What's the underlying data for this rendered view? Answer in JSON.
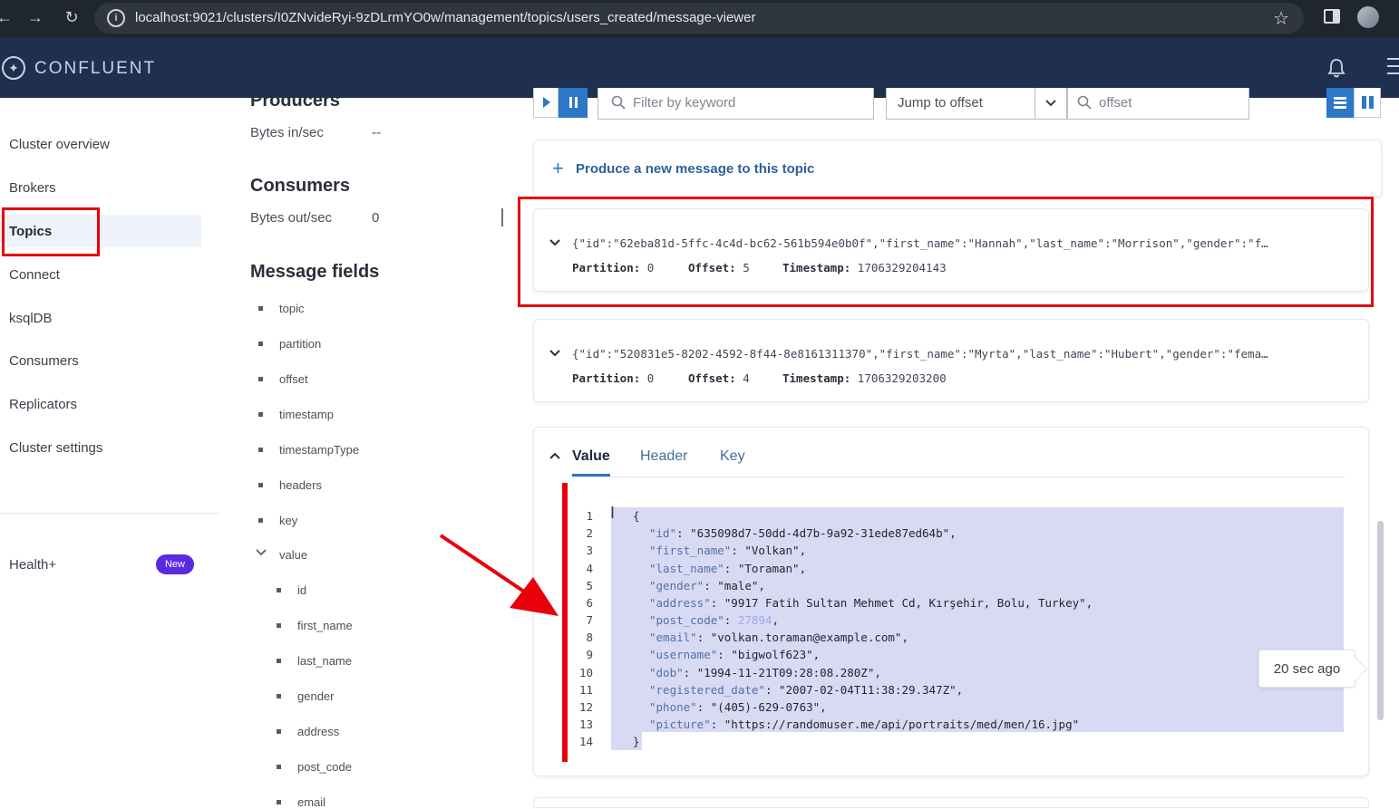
{
  "browser": {
    "url": "localhost:9021/clusters/I0ZNvideRyi-9zDLrmYO0w/management/topics/users_created/message-viewer"
  },
  "header": {
    "brand": "CONFLUENT"
  },
  "sidebar": {
    "items": [
      {
        "label": "Cluster overview"
      },
      {
        "label": "Brokers"
      },
      {
        "label": "Topics"
      },
      {
        "label": "Connect"
      },
      {
        "label": "ksqlDB"
      },
      {
        "label": "Consumers"
      },
      {
        "label": "Replicators"
      },
      {
        "label": "Cluster settings"
      }
    ],
    "health_label": "Health+",
    "health_badge": "New"
  },
  "middle": {
    "producers_heading": "Producers",
    "bytes_in_label": "Bytes in/sec",
    "bytes_in_value": "--",
    "consumers_heading": "Consumers",
    "bytes_out_label": "Bytes out/sec",
    "bytes_out_value": "0",
    "fields_heading": "Message fields",
    "fields": [
      "topic",
      "partition",
      "offset",
      "timestamp",
      "timestampType",
      "headers",
      "key",
      "value"
    ],
    "value_subfields": [
      "id",
      "first_name",
      "last_name",
      "gender",
      "address",
      "post_code",
      "email"
    ]
  },
  "toolbar": {
    "filter_placeholder": "Filter by keyword",
    "jump_label": "Jump to offset",
    "offset_placeholder": "offset"
  },
  "produce": {
    "label": "Produce a new message to this topic"
  },
  "messages": [
    {
      "json": "{\"id\":\"62eba81d-5ffc-4c4d-bc62-561b594e0b0f\",\"first_name\":\"Hannah\",\"last_name\":\"Morrison\",\"gender\":\"f…",
      "partition_label": "Partition:",
      "partition": "0",
      "offset_label": "Offset:",
      "offset": "5",
      "timestamp_label": "Timestamp:",
      "timestamp": "1706329204143"
    },
    {
      "json": "{\"id\":\"520831e5-8202-4592-8f44-8e8161311370\",\"first_name\":\"Myrta\",\"last_name\":\"Hubert\",\"gender\":\"fema…",
      "partition_label": "Partition:",
      "partition": "0",
      "offset_label": "Offset:",
      "offset": "4",
      "timestamp_label": "Timestamp:",
      "timestamp": "1706329203200"
    }
  ],
  "detail": {
    "tabs": [
      "Value",
      "Header",
      "Key"
    ],
    "line_numbers": [
      "1",
      "2",
      "3",
      "4",
      "5",
      "6",
      "7",
      "8",
      "9",
      "10",
      "11",
      "12",
      "13",
      "14"
    ],
    "code": [
      {
        "k": "",
        "v": "{"
      },
      {
        "k": "\"id\"",
        "v": ": \"635098d7-50dd-4d7b-9a92-31ede87ed64b\","
      },
      {
        "k": "\"first_name\"",
        "v": ": \"Volkan\","
      },
      {
        "k": "\"last_name\"",
        "v": ": \"Toraman\","
      },
      {
        "k": "\"gender\"",
        "v": ": \"male\","
      },
      {
        "k": "\"address\"",
        "v": ": \"9917 Fatih Sultan Mehmet Cd, Kırşehir, Bolu, Turkey\","
      },
      {
        "k": "\"post_code\"",
        "v": ": ",
        "num": "27894",
        "tail": ","
      },
      {
        "k": "\"email\"",
        "v": ": \"volkan.toraman@example.com\","
      },
      {
        "k": "\"username\"",
        "v": ": \"bigwolf623\","
      },
      {
        "k": "\"dob\"",
        "v": ": \"1994-11-21T09:28:08.280Z\","
      },
      {
        "k": "\"registered_date\"",
        "v": ": \"2007-02-04T11:38:29.347Z\","
      },
      {
        "k": "\"phone\"",
        "v": ": \"(405)-629-0763\","
      },
      {
        "k": "\"picture\"",
        "v": ": \"https://randomuser.me/api/portraits/med/men/16.jpg\""
      },
      {
        "k": "",
        "v": "}"
      }
    ],
    "time_ago": "20 sec ago"
  },
  "colors": {
    "annotation_red": "#e8000b",
    "accent_blue": "#2d77c7",
    "header_navy": "#1f2f4f",
    "badge_purple": "#5b2ae0"
  }
}
